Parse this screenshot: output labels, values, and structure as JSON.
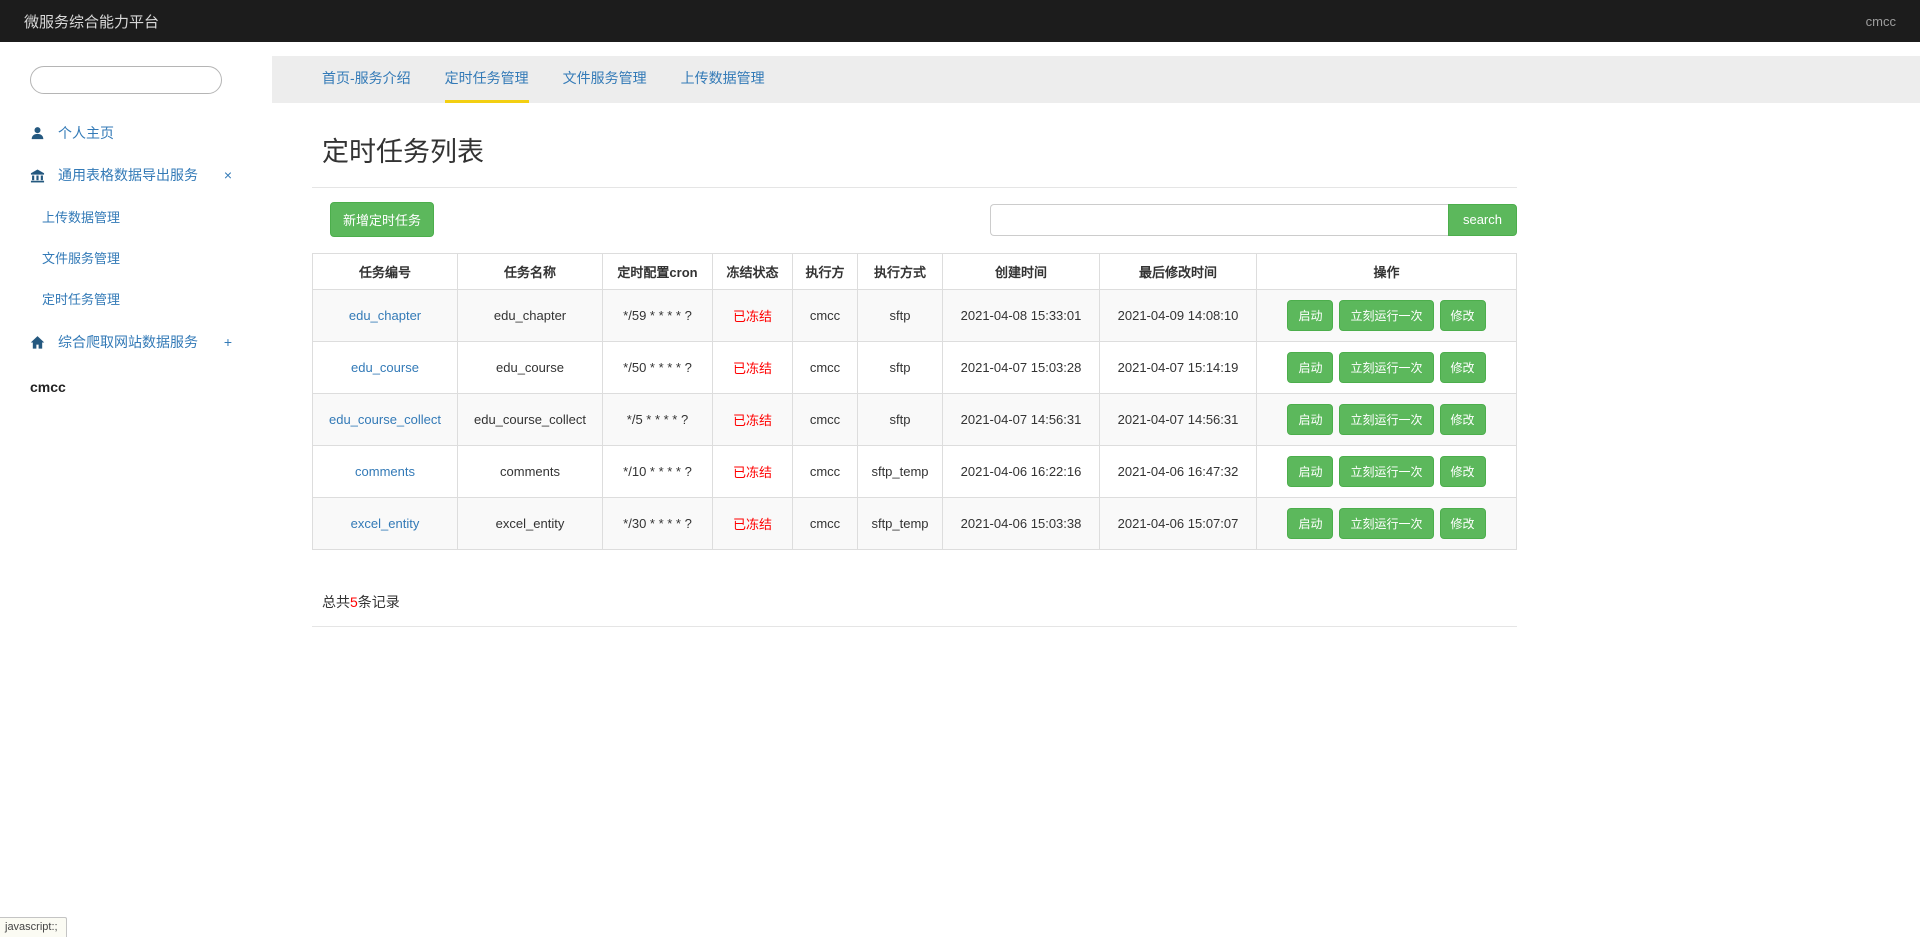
{
  "colors": {
    "navbar_bg": "#1c1c1c",
    "link_blue": "#337ab7",
    "button_green": "#5cb85c",
    "status_red": "#ff0000",
    "active_tab_yellow": "#f3cf11",
    "tabbar_bg": "#ededed"
  },
  "navbar": {
    "title": "微服务综合能力平台",
    "username": "cmcc"
  },
  "sidebar": {
    "search": {
      "value": "",
      "placeholder": ""
    },
    "personal_home": {
      "label": "个人主页",
      "icon": "user-icon"
    },
    "export_service": {
      "label": "通用表格数据导出服务",
      "icon": "library-icon",
      "toggle": "×"
    },
    "export_submenu": [
      "上传数据管理",
      "文件服务管理",
      "定时任务管理"
    ],
    "crawl_service": {
      "label": "综合爬取网站数据服务",
      "icon": "home-icon",
      "toggle": "+"
    },
    "username": "cmcc"
  },
  "tabs": [
    {
      "label": "首页-服务介绍",
      "active": false
    },
    {
      "label": "定时任务管理",
      "active": true
    },
    {
      "label": "文件服务管理",
      "active": false
    },
    {
      "label": "上传数据管理",
      "active": false
    }
  ],
  "main": {
    "page_title": "定时任务列表",
    "add_task_button": "新增定时任务",
    "search": {
      "value": "",
      "placeholder": "",
      "button_label": "search"
    },
    "table": {
      "headers": [
        "任务编号",
        "任务名称",
        "定时配置cron",
        "冻结状态",
        "执行方",
        "执行方式",
        "创建时间",
        "最后修改时间",
        "操作"
      ],
      "action_labels": [
        "启动",
        "立刻运行一次",
        "修改"
      ],
      "rows": [
        {
          "task_id": "edu_chapter",
          "task_name": "edu_chapter",
          "cron": "*/59 * * * * ?",
          "freeze_status": "已冻结",
          "executor": "cmcc",
          "exec_method": "sftp",
          "created_at": "2021-04-08 15:33:01",
          "modified_at": "2021-04-09 14:08:10"
        },
        {
          "task_id": "edu_course",
          "task_name": "edu_course",
          "cron": "*/50 * * * * ?",
          "freeze_status": "已冻结",
          "executor": "cmcc",
          "exec_method": "sftp",
          "created_at": "2021-04-07 15:03:28",
          "modified_at": "2021-04-07 15:14:19"
        },
        {
          "task_id": "edu_course_collect",
          "task_name": "edu_course_collect",
          "cron": "*/5 * * * * ?",
          "freeze_status": "已冻结",
          "executor": "cmcc",
          "exec_method": "sftp",
          "created_at": "2021-04-07 14:56:31",
          "modified_at": "2021-04-07 14:56:31"
        },
        {
          "task_id": "comments",
          "task_name": "comments",
          "cron": "*/10 * * * * ?",
          "freeze_status": "已冻结",
          "executor": "cmcc",
          "exec_method": "sftp_temp",
          "created_at": "2021-04-06 16:22:16",
          "modified_at": "2021-04-06 16:47:32"
        },
        {
          "task_id": "excel_entity",
          "task_name": "excel_entity",
          "cron": "*/30 * * * * ?",
          "freeze_status": "已冻结",
          "executor": "cmcc",
          "exec_method": "sftp_temp",
          "created_at": "2021-04-06 15:03:38",
          "modified_at": "2021-04-06 15:07:07"
        }
      ]
    },
    "summary": {
      "prefix": "总共",
      "count": "5",
      "suffix": "条记录"
    }
  },
  "status_bar": {
    "text": "javascript:;"
  }
}
